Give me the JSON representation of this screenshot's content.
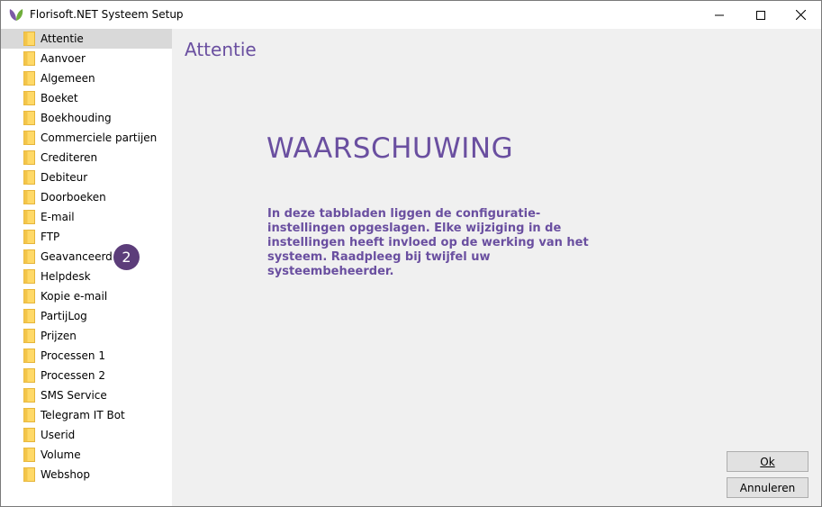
{
  "window": {
    "title": "Florisoft.NET Systeem Setup"
  },
  "sidebar": {
    "items": [
      {
        "label": "Attentie",
        "selected": true
      },
      {
        "label": "Aanvoer"
      },
      {
        "label": "Algemeen"
      },
      {
        "label": "Boeket"
      },
      {
        "label": "Boekhouding"
      },
      {
        "label": "Commerciele partijen"
      },
      {
        "label": "Crediteren"
      },
      {
        "label": "Debiteur"
      },
      {
        "label": "Doorboeken"
      },
      {
        "label": "E-mail"
      },
      {
        "label": "FTP"
      },
      {
        "label": "Geavanceerd"
      },
      {
        "label": "Helpdesk"
      },
      {
        "label": "Kopie e-mail"
      },
      {
        "label": "PartijLog"
      },
      {
        "label": "Prijzen"
      },
      {
        "label": "Processen 1"
      },
      {
        "label": "Processen 2"
      },
      {
        "label": "SMS Service"
      },
      {
        "label": "Telegram IT Bot"
      },
      {
        "label": "Userid"
      },
      {
        "label": "Volume"
      },
      {
        "label": "Webshop"
      }
    ],
    "badge": "2"
  },
  "main": {
    "page_title": "Attentie",
    "warning_heading": "WAARSCHUWING",
    "warning_text": "In deze tabbladen liggen de configuratie- instellingen opgeslagen. Elke wijziging in de instellingen heeft invloed op de werking van het systeem. Raadpleeg bij twijfel uw systeembeheerder."
  },
  "buttons": {
    "ok": "Ok",
    "cancel": "Annuleren"
  },
  "colors": {
    "accent": "#6a4fa0",
    "badge": "#5c3d7a",
    "folder": "#ffd967"
  }
}
